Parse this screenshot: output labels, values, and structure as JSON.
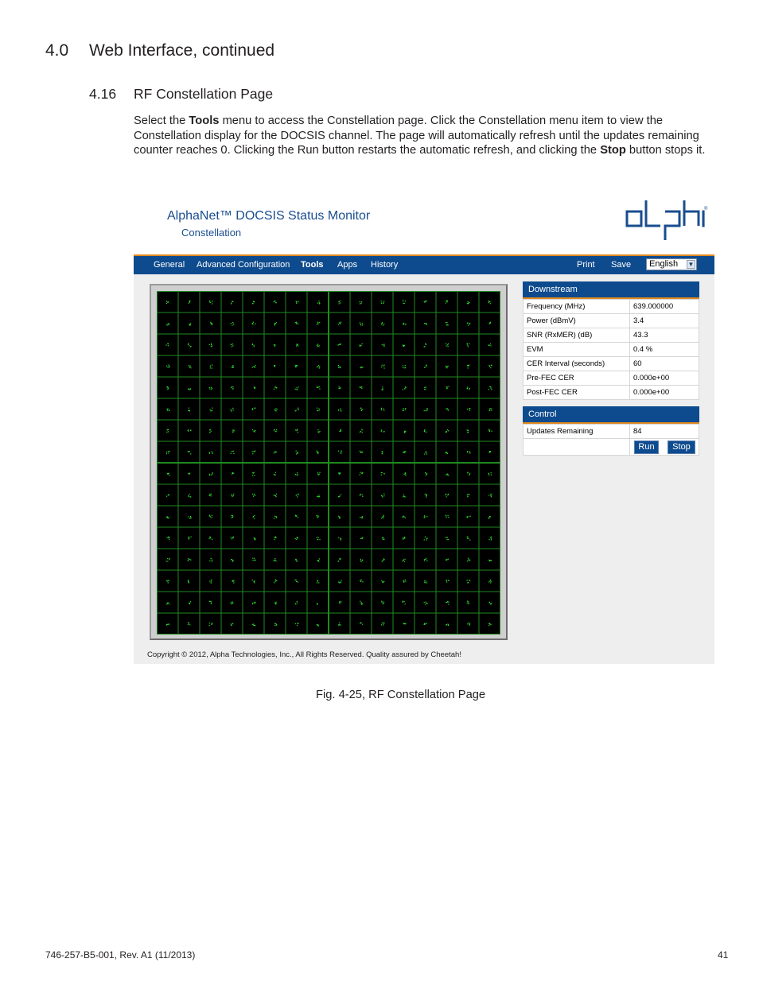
{
  "section_heading": {
    "number": "4.0",
    "title": "Web Interface, continued"
  },
  "subsection_heading": {
    "number": "4.16",
    "title": "RF Constellation Page"
  },
  "paragraph": {
    "p1": "Select the ",
    "b1": "Tools",
    "p2": " menu to access the Constellation page. Click the Constellation menu item to view the Constellation display for the DOCSIS channel. The page will automatically refresh until the updates remaining counter reaches 0. Clicking the Run button restarts the automatic refresh, and clicking the ",
    "b2": "Stop",
    "p3": " button stops it."
  },
  "screenshot": {
    "app_title": "AlphaNet™ DOCSIS Status Monitor",
    "app_subtitle": "Constellation",
    "nav": {
      "items": [
        "General",
        "Advanced Configuration",
        "Tools",
        "Apps",
        "History"
      ],
      "active": "Tools",
      "print_label": "Print",
      "save_label": "Save",
      "language": "English"
    },
    "downstream": {
      "header": "Downstream",
      "rows": [
        {
          "label": "Frequency (MHz)",
          "value": "639.000000"
        },
        {
          "label": "Power (dBmV)",
          "value": "3.4"
        },
        {
          "label": "SNR (RxMER) (dB)",
          "value": "43.3"
        },
        {
          "label": "EVM",
          "value": "0.4 %"
        },
        {
          "label": "CER Interval (seconds)",
          "value": "60"
        },
        {
          "label": "Pre-FEC CER",
          "value": "0.000e+00"
        },
        {
          "label": "Post-FEC CER",
          "value": "0.000e+00"
        }
      ]
    },
    "control": {
      "header": "Control",
      "updates_label": "Updates Remaining",
      "updates_value": "84",
      "run_label": "Run",
      "stop_label": "Stop"
    },
    "constellation": {
      "grid_size": 16,
      "point_color": "#2fe02f",
      "background": "#000000",
      "grid_color": "#1f8a1f"
    },
    "copyright": "Copyright © 2012, Alpha Technologies, Inc., All Rights Reserved. Quality assured by Cheetah!"
  },
  "caption": "Fig. 4-25, RF Constellation Page",
  "footer": {
    "doc_id": "746-257-B5-001, Rev. A1 (11/2013)",
    "page_number": "41"
  }
}
